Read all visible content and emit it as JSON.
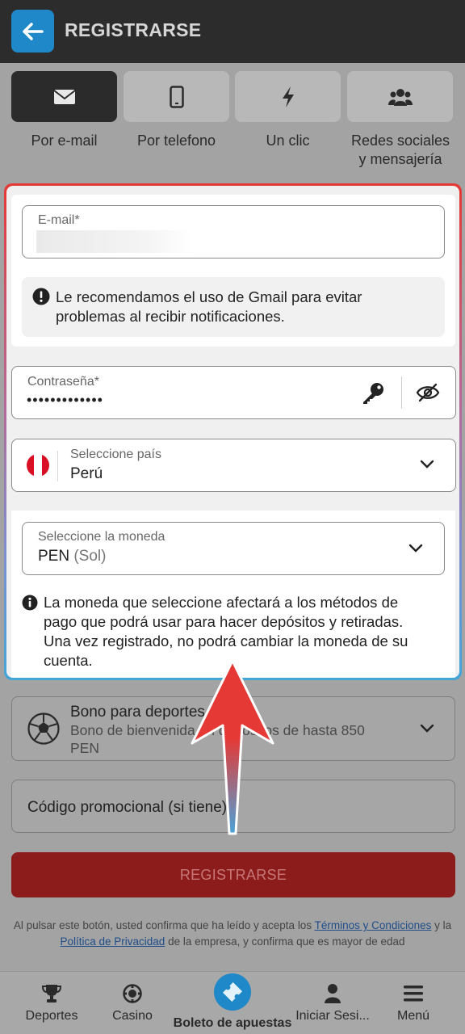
{
  "header": {
    "title": "REGISTRARSE"
  },
  "methods": [
    {
      "label": "Por e-mail",
      "icon": "envelope-icon"
    },
    {
      "label": "Por telefono",
      "icon": "phone-icon"
    },
    {
      "label": "Un clic",
      "icon": "lightning-icon"
    },
    {
      "label_line1": "Redes sociales",
      "label_line2": "y mensajería",
      "icon": "users-icon"
    }
  ],
  "form": {
    "email": {
      "label": "E-mail*",
      "value": ""
    },
    "gmail_notice": {
      "line1": "Le recomendamos el uso de Gmail para evitar",
      "line2": "problemas al recibir notificaciones."
    },
    "password": {
      "label": "Contraseña*",
      "value": "•••••••••••••"
    },
    "country": {
      "label": "Seleccione país",
      "value": "Perú"
    },
    "currency": {
      "label": "Seleccione la moneda",
      "code": "PEN",
      "name": "(Sol)"
    },
    "currency_notice": {
      "line1": "La moneda que seleccione afectará a los métodos de",
      "line2": "pago que podrá usar para hacer depósitos y retiradas.",
      "line3": "Una vez registrado, no podrá cambiar la moneda de su",
      "line4": "cuenta."
    }
  },
  "bonus": {
    "title": "Bono para deportes",
    "desc_line1": "Bono de bienvenida en depósitos de hasta 850",
    "desc_line2": "PEN"
  },
  "promo": {
    "label": "Código promocional (si tiene)"
  },
  "register_button": "REGISTRARSE",
  "legal": {
    "part1": "Al pulsar este botón, usted confirma que ha leído y acepta los ",
    "terms_link": "Términos y Condiciones",
    "part2": " y la ",
    "privacy_link": "Política de Privacidad",
    "part3": " de la empresa, y confirma que es mayor de edad"
  },
  "bottom_nav": [
    {
      "label": "Deportes",
      "icon": "trophy-icon"
    },
    {
      "label": "Casino",
      "icon": "casino-chip-icon"
    },
    {
      "label": "Boleto de apuestas",
      "icon": "ticket-icon"
    },
    {
      "label": "Iniciar Sesi...",
      "icon": "user-icon"
    },
    {
      "label": "Menú",
      "icon": "menu-icon"
    }
  ],
  "colors": {
    "accent_blue": "#1e88c8",
    "brand_red": "#e53935",
    "frame_blue": "#42a5d8"
  }
}
